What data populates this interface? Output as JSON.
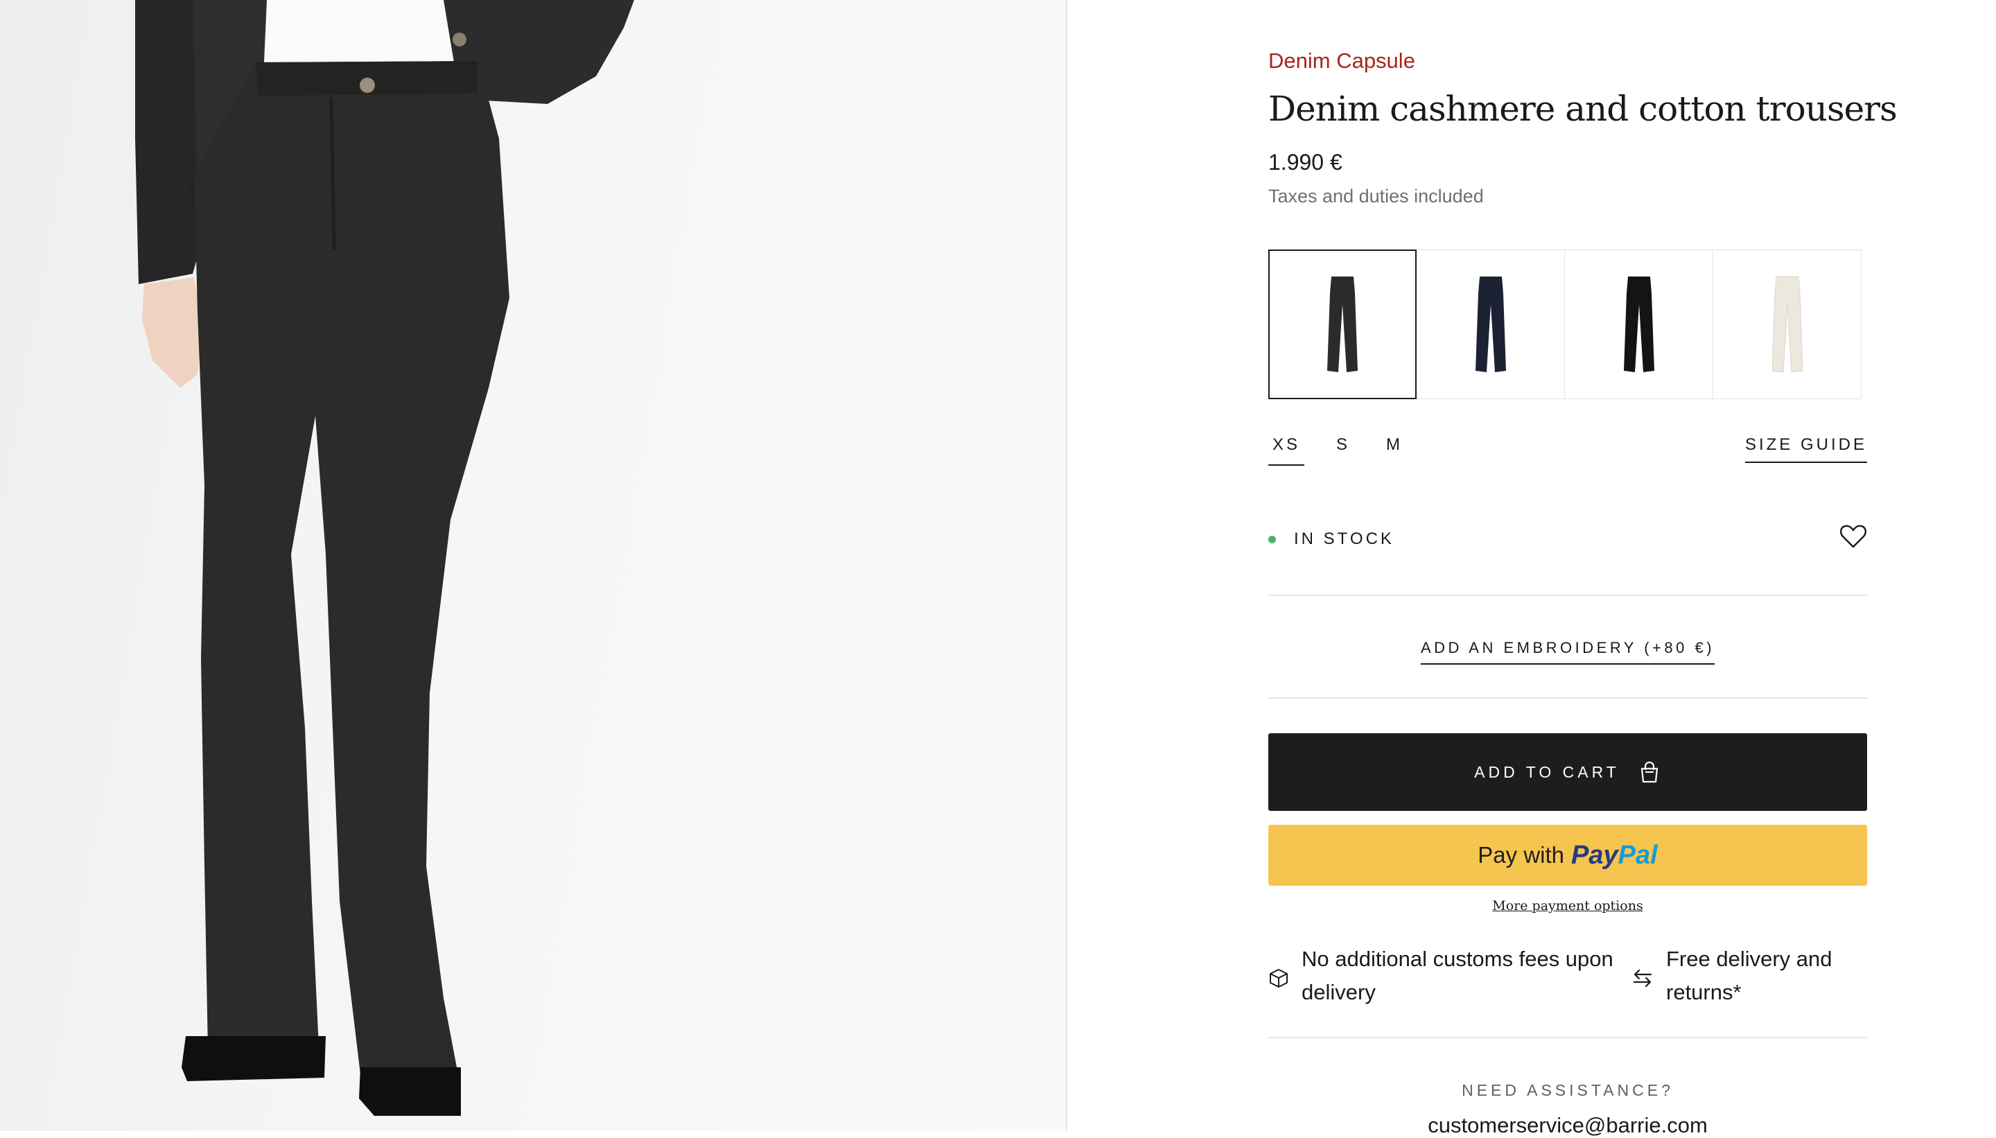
{
  "product": {
    "collection": "Denim Capsule",
    "title": "Denim cashmere and cotton trousers",
    "price": "1.990 €",
    "tax_note": "Taxes and duties included"
  },
  "swatches": [
    {
      "name": "charcoal",
      "color": "#2b2b2b",
      "selected": true
    },
    {
      "name": "navy",
      "color": "#1c2233",
      "selected": false
    },
    {
      "name": "black",
      "color": "#141414",
      "selected": false
    },
    {
      "name": "ivory",
      "color": "#ece8dd",
      "selected": false
    }
  ],
  "sizes": {
    "options": [
      "XS",
      "S",
      "M"
    ],
    "selected": "XS",
    "guide_label": "SIZE GUIDE"
  },
  "stock": {
    "label": "IN STOCK",
    "dot_color": "#4caf6e"
  },
  "embroidery_label": "ADD AN EMBROIDERY (+80 €)",
  "cart": {
    "label": "ADD TO CART",
    "icon": "shopping-bag-icon"
  },
  "paypal": {
    "pay_with": "Pay with",
    "brand_1": "Pay",
    "brand_2": "Pal",
    "more_options": "More payment options"
  },
  "features": [
    {
      "icon": "box-icon",
      "text": "No additional customs fees upon delivery"
    },
    {
      "icon": "exchange-arrows-icon",
      "text": "Free delivery and returns*"
    }
  ],
  "assistance": {
    "heading": "NEED ASSISTANCE?",
    "email": "customerservice@barrie.com"
  },
  "colors": {
    "accent_red": "#a8231b",
    "button_dark": "#1d1d1b",
    "paypal_yellow": "#f6c54f"
  }
}
